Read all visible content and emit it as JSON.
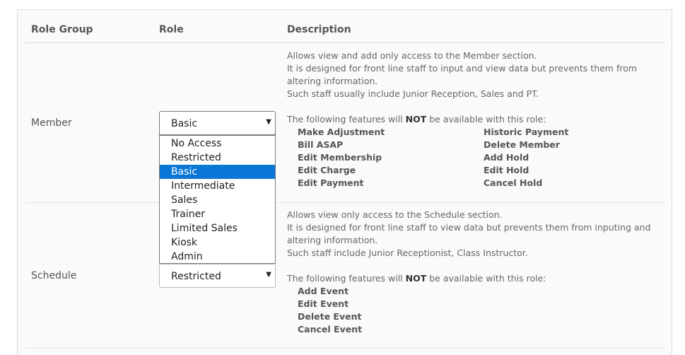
{
  "headers": {
    "role_group": "Role Group",
    "role": "Role",
    "description": "Description"
  },
  "dropdown_options": [
    "No Access",
    "Restricted",
    "Basic",
    "Intermediate",
    "Sales",
    "Trainer",
    "Limited Sales",
    "Kiosk",
    "Admin"
  ],
  "member": {
    "group": "Member",
    "role_value": "Basic",
    "desc_lines": [
      "Allows view and add only access to the Member section.",
      "It is designed for front line staff to input and view data but prevents them from altering information.",
      "Such staff usually include Junior Reception, Sales and PT."
    ],
    "not_prefix": "The following features will ",
    "not_word": "NOT",
    "not_suffix": " be available with this role:",
    "features_left": [
      "Make Adjustment",
      "Bill ASAP",
      "Edit Membership",
      "Edit Charge",
      "Edit Payment"
    ],
    "features_right": [
      "Historic Payment",
      "Delete Member",
      "Add Hold",
      "Edit Hold",
      "Cancel Hold"
    ]
  },
  "schedule": {
    "group": "Schedule",
    "role_value": "Restricted",
    "desc_lines": [
      "Allows view only access to the Schedule section.",
      "It is designed for front line staff to view data but prevents them from inputing and altering information.",
      "Such staff include Junior Receptionist, Class Instructor."
    ],
    "not_prefix": "The following features will ",
    "not_word": "NOT",
    "not_suffix": " be available with this role:",
    "features": [
      "Add Event",
      "Edit Event",
      "Delete Event",
      "Cancel Event"
    ]
  },
  "colors": {
    "selected_option_bg": "#0a76d8",
    "panel_bg": "#fafafa"
  }
}
